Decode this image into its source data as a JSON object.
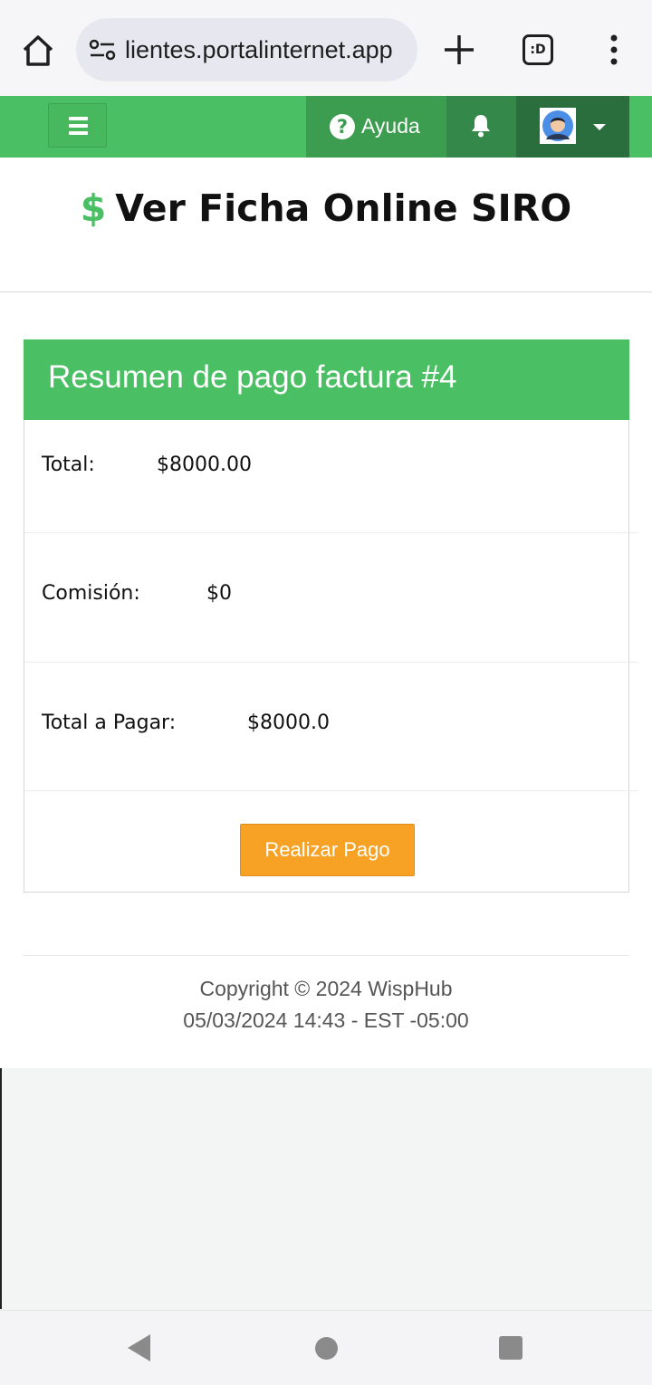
{
  "browser": {
    "url": "lientes.portalinternet.app",
    "tabs_count": ":D"
  },
  "topnav": {
    "help_label": "Ayuda"
  },
  "page": {
    "title_icon": "$",
    "title": "Ver Ficha Online SIRO"
  },
  "payment_panel": {
    "heading": "Resumen de pago factura #4",
    "rows": [
      {
        "label": "Total:",
        "value": "$8000.00"
      },
      {
        "label": "Comisión:",
        "value": "$0"
      },
      {
        "label": "Total a Pagar:",
        "value": "$8000.0"
      }
    ],
    "pay_button": "Realizar Pago"
  },
  "footer": {
    "copyright": "Copyright © 2024 WispHub",
    "timestamp": "05/03/2024 14:43 - EST -05:00"
  },
  "colors": {
    "brand_green": "#4bbf63",
    "pay_orange": "#f7a225"
  },
  "icons": [
    "home-icon",
    "site-settings-icon",
    "new-tab-icon",
    "tabs-icon",
    "more-menu-icon",
    "hamburger-icon",
    "help-icon",
    "bell-icon",
    "avatar",
    "caret-down-icon",
    "back-icon",
    "home-circle-icon",
    "recents-icon"
  ]
}
